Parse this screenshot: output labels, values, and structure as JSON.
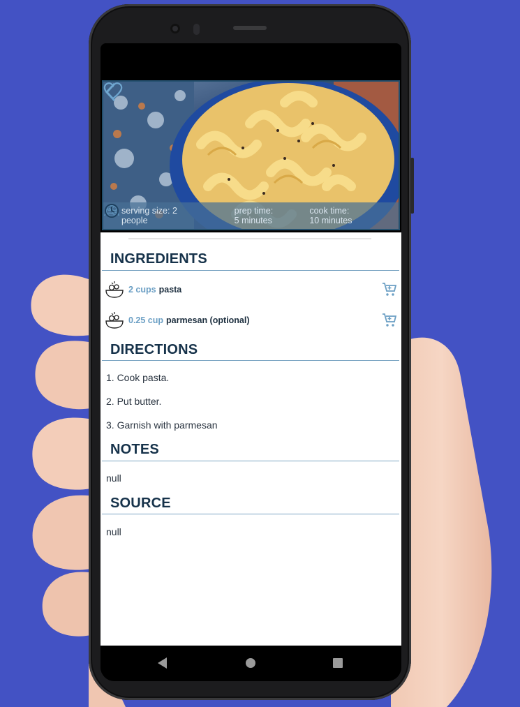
{
  "recipe": {
    "serving_label": "serving size: 2 people",
    "prep_label": "prep time: 5 minutes",
    "cook_label": "cook time: 10 minutes",
    "serving_line1": "serving size: 2",
    "serving_line2": "people",
    "prep_line1": "prep time:",
    "prep_line2": "5 minutes",
    "cook_line1": "cook time:",
    "cook_line2": "10 minutes"
  },
  "sections": {
    "ingredients": "INGREDIENTS",
    "directions": "DIRECTIONS",
    "notes": "NOTES",
    "source": "SOURCE"
  },
  "ingredients": [
    {
      "amount": "2 cups",
      "name": "pasta"
    },
    {
      "amount": "0.25 cup",
      "name": "parmesan (optional)"
    }
  ],
  "directions": [
    "1. Cook pasta.",
    "2. Put butter.",
    "3. Garnish with parmesan"
  ],
  "notes": "null",
  "source": "null",
  "icons": {
    "back": "chevron-left-icon",
    "favorite": "heart-outline-icon",
    "serving": "people-icon",
    "prep": "timer-icon",
    "cook": "clock-icon",
    "ingredient": "bowl-icon",
    "cart": "shopping-cart-icon"
  },
  "colors": {
    "background": "#4352c4",
    "heading": "#16324a",
    "accent": "#6b9fc4",
    "rule": "#7aa4c2"
  }
}
